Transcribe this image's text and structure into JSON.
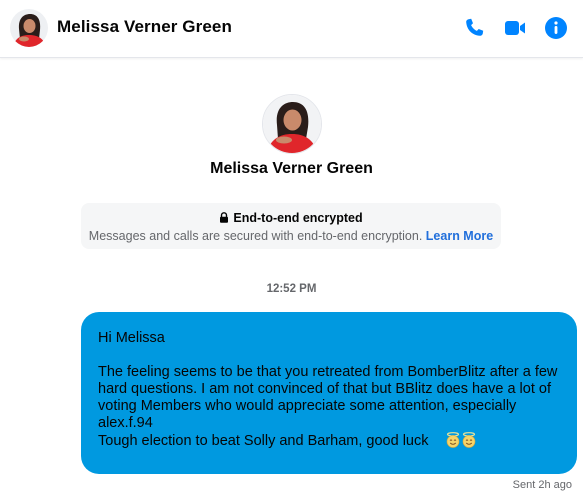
{
  "header": {
    "contact_name": "Melissa Verner Green",
    "icons": [
      "phone-icon",
      "video-camera-icon",
      "info-icon"
    ]
  },
  "profile": {
    "name": "Melissa Verner Green"
  },
  "encryption": {
    "title": "End-to-end encrypted",
    "description": "Messages and calls are secured with end-to-end encryption.",
    "link_label": "Learn More"
  },
  "timestamp": "12:52 PM",
  "message": {
    "greeting": "Hi Melissa",
    "body": "The feeling seems to be that you retreated from BomberBlitz after a few hard questions. I am not convinced of that but BBlitz does have a lot of voting Members who would appreciate some attention, especially alex.f.94",
    "closing": "Tough election to beat Solly and Barham, good luck",
    "emoji": [
      "smiling-face-with-halo-icon",
      "smiling-face-with-halo-icon"
    ],
    "status": "Sent 2h ago"
  },
  "colors": {
    "accent": "#0084ff",
    "bubble": "#0099e0",
    "link": "#216fdb",
    "muted_text": "#65676b",
    "notice_bg": "#f5f6f7"
  }
}
